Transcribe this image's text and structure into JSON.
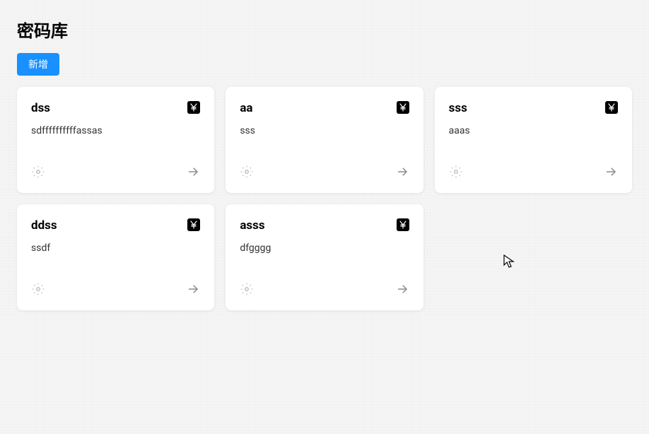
{
  "page": {
    "title": "密码库",
    "add_button_label": "新增"
  },
  "cards": [
    {
      "title": "dss",
      "description": "sdffffffffffassas",
      "badge_icon": "yen-icon"
    },
    {
      "title": "aa",
      "description": "sss",
      "badge_icon": "yen-icon"
    },
    {
      "title": "sss",
      "description": "aaas",
      "badge_icon": "yen-icon"
    },
    {
      "title": "ddss",
      "description": "ssdf",
      "badge_icon": "yen-icon"
    },
    {
      "title": "asss",
      "description": "dfgggg",
      "badge_icon": "yen-icon"
    }
  ]
}
